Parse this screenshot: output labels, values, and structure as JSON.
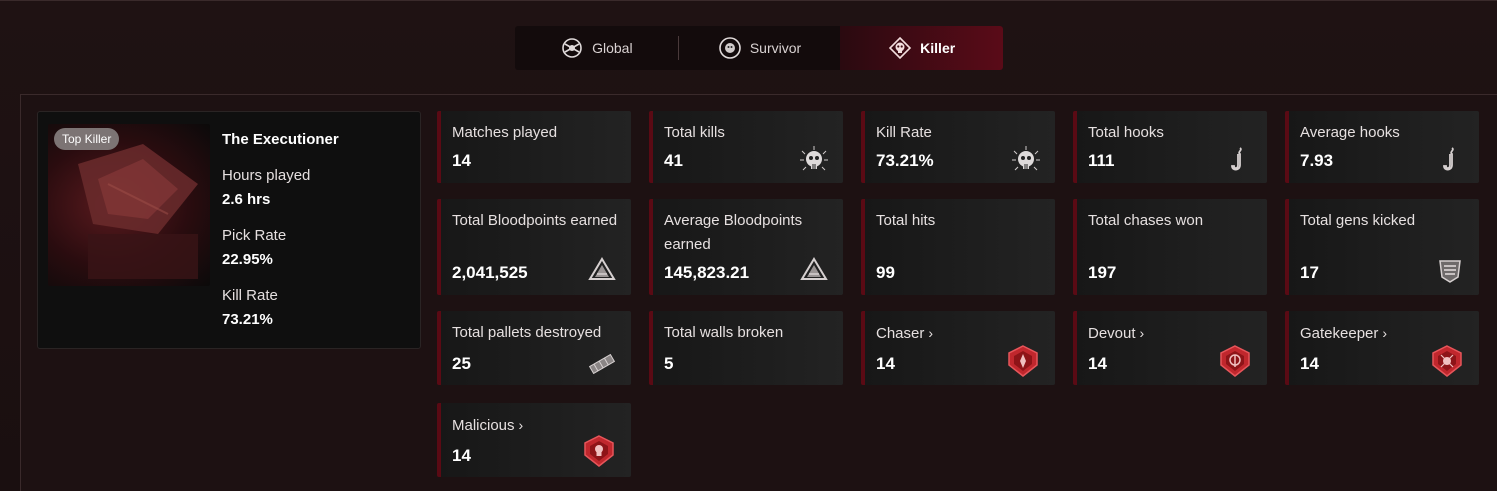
{
  "tabs": [
    {
      "label": "Global",
      "icon": "global-icon"
    },
    {
      "label": "Survivor",
      "icon": "survivor-icon"
    },
    {
      "label": "Killer",
      "icon": "killer-icon",
      "active": true
    }
  ],
  "killer": {
    "badge": "Top Killer",
    "name": "The Executioner",
    "hours_label": "Hours played",
    "hours_value": "2.6 hrs",
    "pick_label": "Pick Rate",
    "pick_value": "22.95%",
    "kill_label": "Kill Rate",
    "kill_value": "73.21%"
  },
  "stats": [
    {
      "label": "Matches played",
      "value": "14",
      "icon": "none"
    },
    {
      "label": "Total kills",
      "value": "41",
      "icon": "skull-icon"
    },
    {
      "label": "Kill Rate",
      "value": "73.21%",
      "icon": "skull-icon"
    },
    {
      "label": "Total hooks",
      "value": "111",
      "icon": "hook-icon"
    },
    {
      "label": "Average hooks",
      "value": "7.93",
      "icon": "hook-icon"
    },
    {
      "label": "Total Bloodpoints earned",
      "value": "2,041,525",
      "icon": "bloodpoints-icon"
    },
    {
      "label": "Average Bloodpoints earned",
      "value": "145,823.21",
      "icon": "bloodpoints-icon"
    },
    {
      "label": "Total hits",
      "value": "99",
      "icon": "none"
    },
    {
      "label": "Total chases won",
      "value": "197",
      "icon": "none"
    },
    {
      "label": "Total gens kicked",
      "value": "17",
      "icon": "generator-icon"
    },
    {
      "label": "Total pallets destroyed",
      "value": "25",
      "icon": "pallet-icon"
    },
    {
      "label": "Total walls broken",
      "value": "5",
      "icon": "none"
    },
    {
      "label": "Chaser",
      "value": "14",
      "icon": "emblem-icon",
      "chevron": "›"
    },
    {
      "label": "Devout",
      "value": "14",
      "icon": "emblem-icon",
      "chevron": "›"
    },
    {
      "label": "Gatekeeper",
      "value": "14",
      "icon": "emblem-icon",
      "chevron": "›"
    },
    {
      "label": "Malicious",
      "value": "14",
      "icon": "emblem-icon",
      "chevron": "›"
    }
  ],
  "colors": {
    "accent": "#5a0b18",
    "emblem": "#c0272d",
    "background": "#1c1011"
  }
}
